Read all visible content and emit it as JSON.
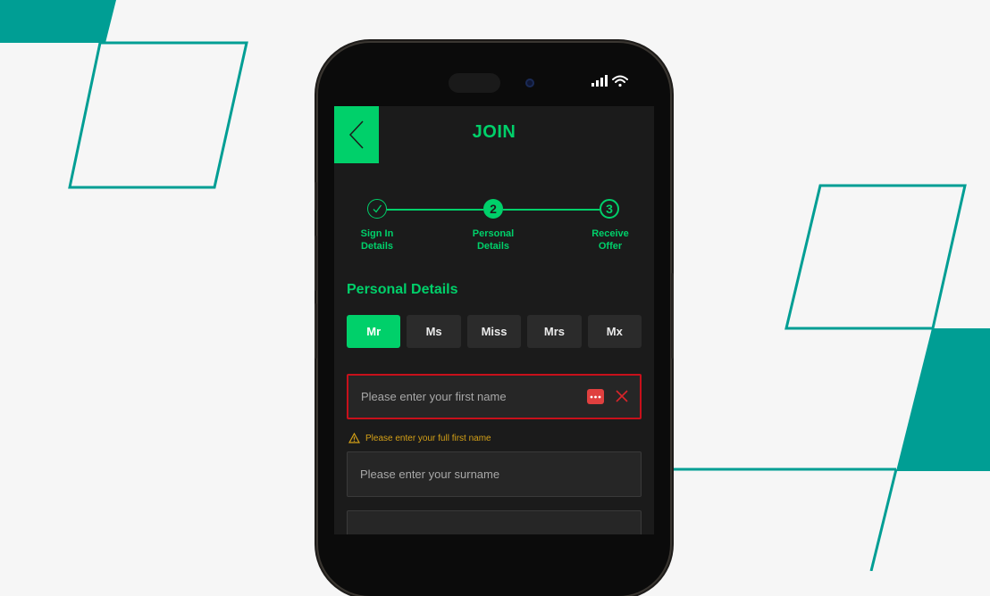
{
  "header": {
    "title": "JOIN"
  },
  "stepper": {
    "steps": [
      {
        "label_line1": "Sign In",
        "label_line2": "Details",
        "state": "done",
        "number": ""
      },
      {
        "label_line1": "Personal",
        "label_line2": "Details",
        "state": "active",
        "number": "2"
      },
      {
        "label_line1": "Receive",
        "label_line2": "Offer",
        "state": "todo",
        "number": "3"
      }
    ]
  },
  "form": {
    "section_title": "Personal Details",
    "title_options": [
      "Mr",
      "Ms",
      "Miss",
      "Mrs",
      "Mx"
    ],
    "selected_title": "Mr",
    "first_name": {
      "value": "",
      "placeholder": "Please enter your first name",
      "error": "Please enter your full first name"
    },
    "surname": {
      "value": "",
      "placeholder": "Please enter your surname"
    }
  },
  "colors": {
    "accent": "#00d06a",
    "decoration_teal": "#009e94",
    "error_red": "#c8101b",
    "warning_yellow": "#d4a017",
    "screen_bg": "#1b1b1b"
  },
  "icons": {
    "back": "chevron-left-icon",
    "completed_step": "check-icon",
    "password_manager": "dots-icon",
    "clear": "close-icon",
    "warning": "warning-icon",
    "signal": "signal-icon",
    "wifi": "wifi-icon"
  }
}
